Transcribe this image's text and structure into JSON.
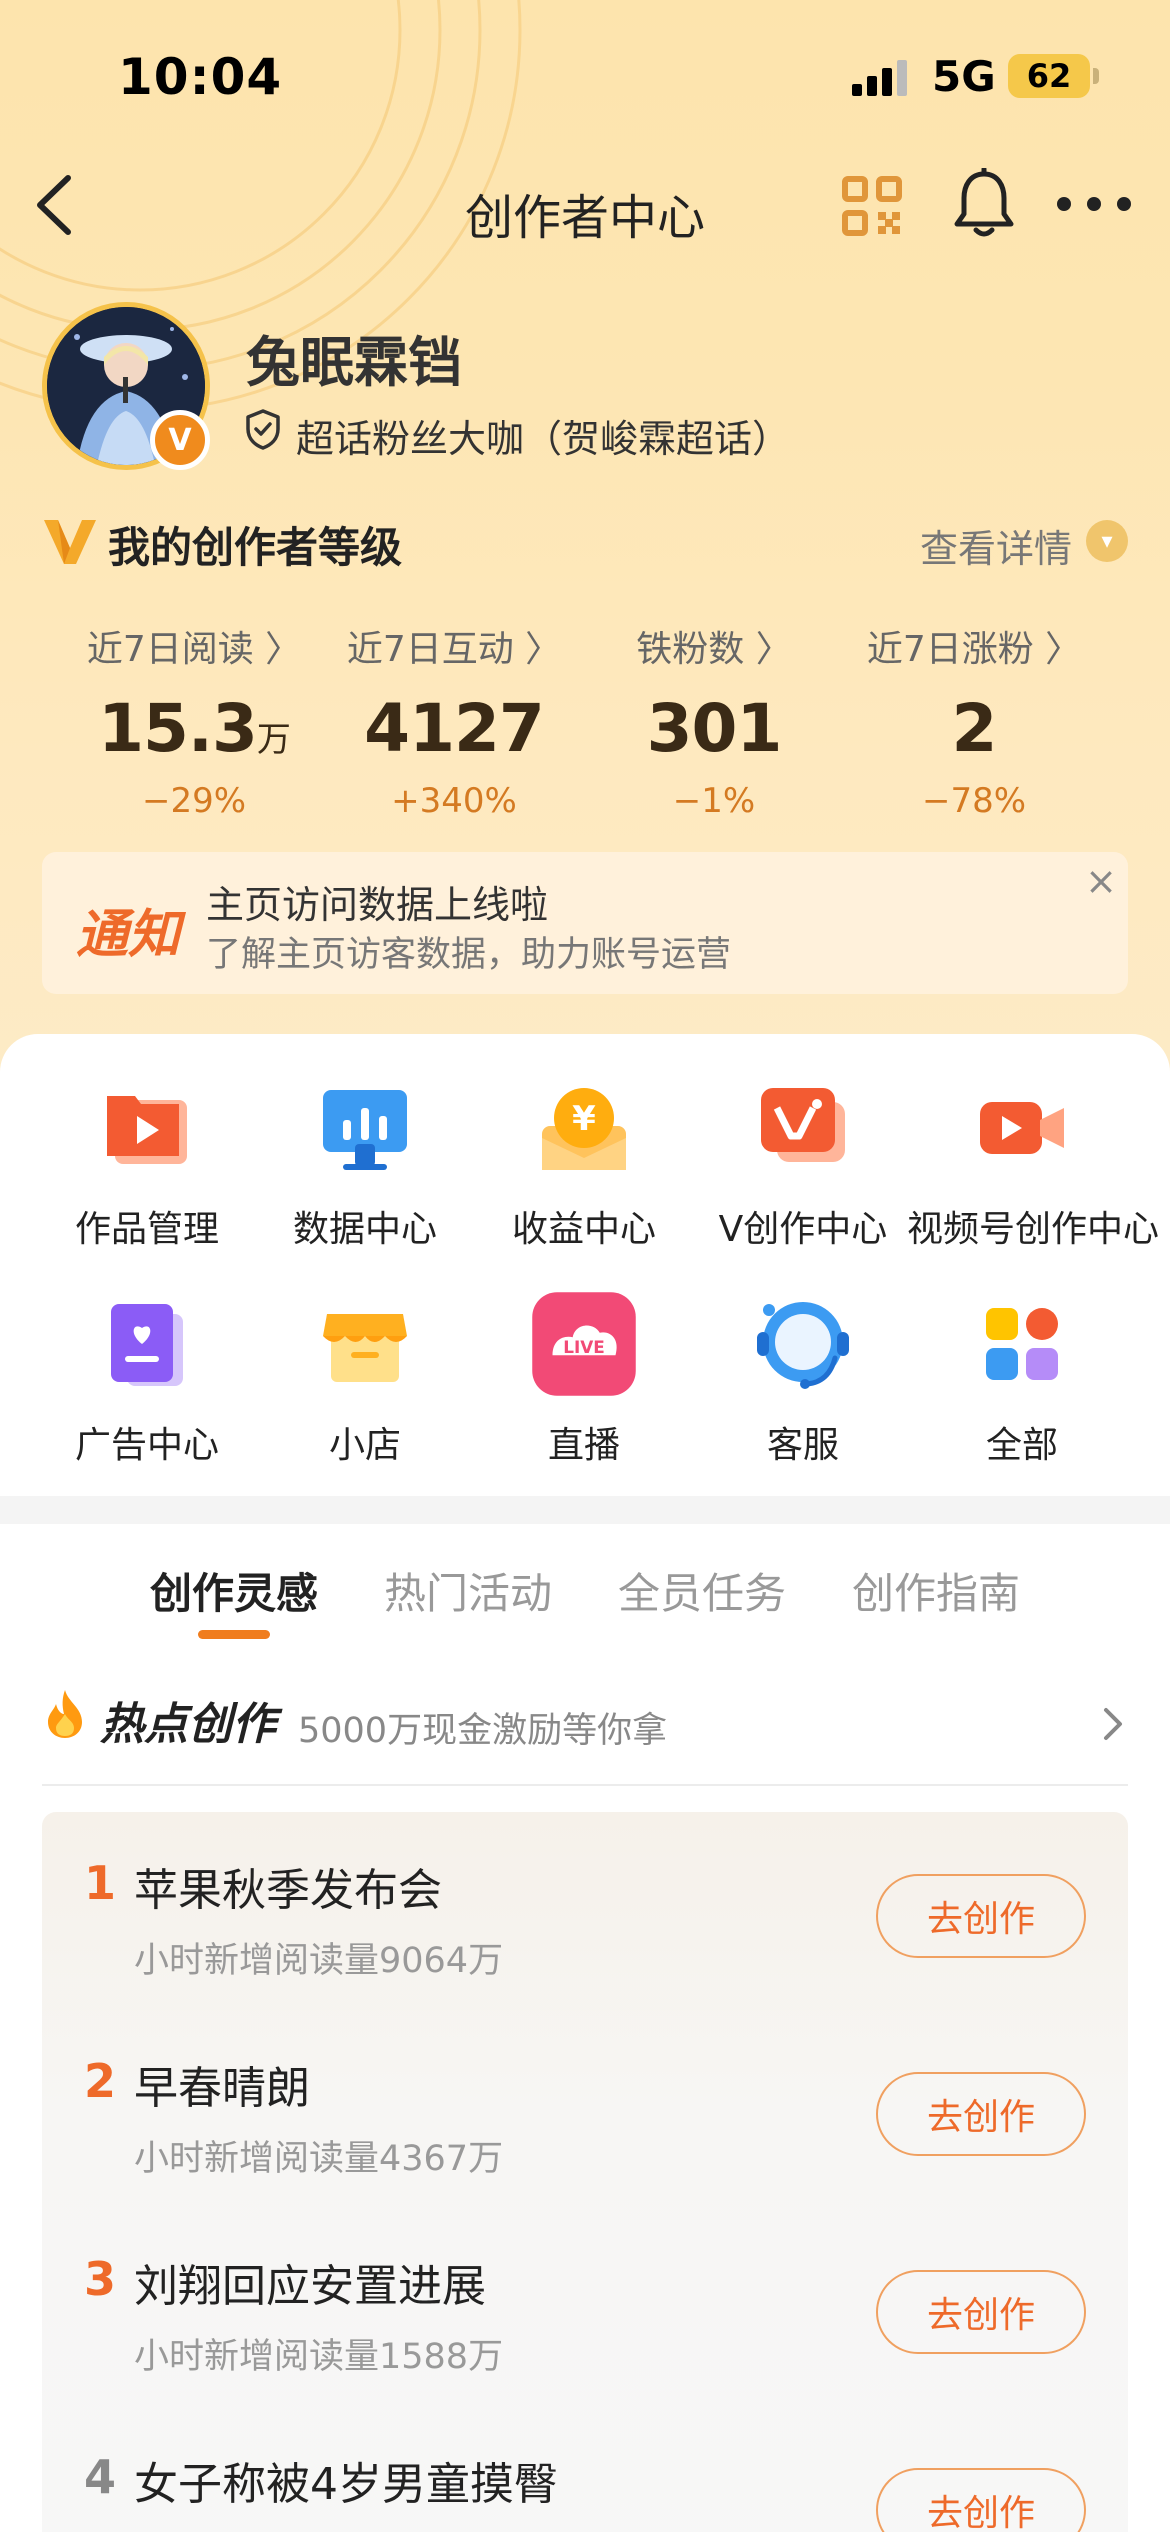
{
  "status_bar": {
    "time": "10:04",
    "network": "5G",
    "battery": "62"
  },
  "nav": {
    "title": "创作者中心",
    "icons": [
      "back-icon",
      "qr-code-icon",
      "bell-icon",
      "more-icon"
    ]
  },
  "profile": {
    "name": "兔眠霖铛",
    "title": "超话粉丝大咖（贺峻霖超话）",
    "badge": "V"
  },
  "level": {
    "title": "我的创作者等级",
    "detail": "查看详情"
  },
  "stats": [
    {
      "label": "近7日阅读 〉",
      "value": "15.3",
      "unit": "万",
      "change": "−29%"
    },
    {
      "label": "近7日互动 〉",
      "value": "4127",
      "unit": "",
      "change": "+340%"
    },
    {
      "label": "铁粉数 〉",
      "value": "301",
      "unit": "",
      "change": "−1%"
    },
    {
      "label": "近7日涨粉 〉",
      "value": "2",
      "unit": "",
      "change": "−78%"
    }
  ],
  "notice": {
    "tag": "通知",
    "title": "主页访问数据上线啦",
    "subtitle": "了解主页访客数据，助力账号运营",
    "close": "×"
  },
  "tools": [
    {
      "label": "作品管理",
      "icon": "works-manage-icon"
    },
    {
      "label": "数据中心",
      "icon": "data-center-icon"
    },
    {
      "label": "收益中心",
      "icon": "income-center-icon"
    },
    {
      "label": "V创作中心",
      "icon": "v-creator-icon"
    },
    {
      "label": "视频号创作中心",
      "icon": "video-creator-icon"
    },
    {
      "label": "广告中心",
      "icon": "ad-center-icon"
    },
    {
      "label": "小店",
      "icon": "shop-icon"
    },
    {
      "label": "直播",
      "icon": "live-icon"
    },
    {
      "label": "客服",
      "icon": "customer-service-icon"
    },
    {
      "label": "全部",
      "icon": "all-apps-icon"
    }
  ],
  "tabs": [
    {
      "label": "创作灵感",
      "active": true
    },
    {
      "label": "热门活动",
      "active": false
    },
    {
      "label": "全员任务",
      "active": false
    },
    {
      "label": "创作指南",
      "active": false
    }
  ],
  "hot": {
    "title": "热点创作",
    "subtitle": "5000万现金激励等你拿",
    "items": [
      {
        "rank": "1",
        "name": "苹果秋季发布会",
        "meta": "小时新增阅读量9064万",
        "button": "去创作"
      },
      {
        "rank": "2",
        "name": "早春晴朗",
        "meta": "小时新增阅读量4367万",
        "button": "去创作"
      },
      {
        "rank": "3",
        "name": "刘翔回应安置进展",
        "meta": "小时新增阅读量1588万",
        "button": "去创作"
      },
      {
        "rank": "4",
        "name": "女子称被4岁男童摸臀",
        "meta": "",
        "button": "去创作"
      }
    ]
  },
  "colors": {
    "accent": "#ee6a2a",
    "header_bg": "#fde4ad",
    "stat_value": "#3a2a16"
  }
}
